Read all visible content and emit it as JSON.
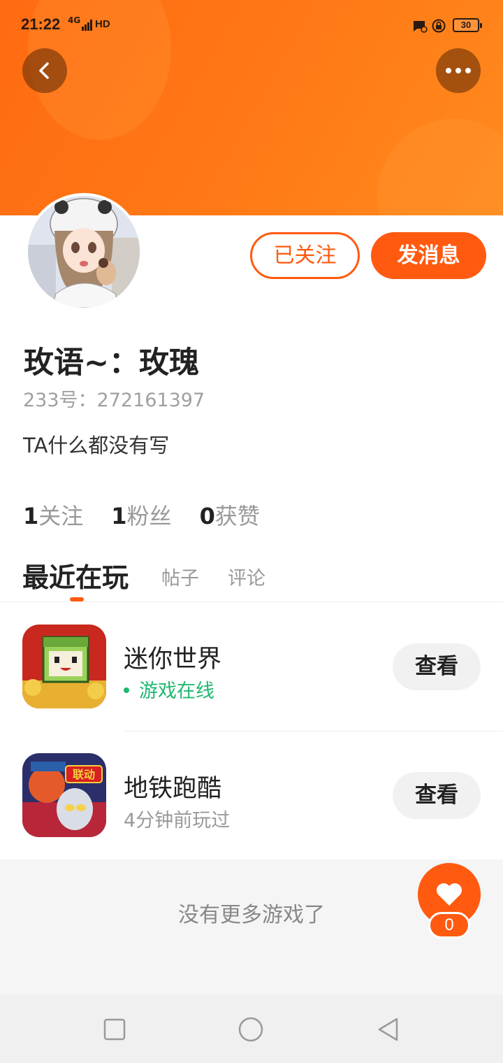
{
  "status_bar": {
    "time": "21:22",
    "network": "4G",
    "hd": "HD",
    "battery": "30"
  },
  "profile": {
    "follow_button": "已关注",
    "message_button": "发消息",
    "name": "玫语~：玫瑰",
    "id_text": "233号：272161397",
    "bio": "TA什么都没有写"
  },
  "stats": [
    {
      "count": "1",
      "label": "关注"
    },
    {
      "count": "1",
      "label": "粉丝"
    },
    {
      "count": "0",
      "label": "获赞"
    }
  ],
  "tabs": [
    "最近在玩",
    "帖子",
    "评论"
  ],
  "games": [
    {
      "title": "迷你世界",
      "status": "游戏在线",
      "button": "查看"
    },
    {
      "title": "地铁跑酷",
      "status": "4分钟前玩过",
      "button": "查看",
      "badge": "联动"
    }
  ],
  "footer": {
    "no_more": "没有更多游戏了"
  },
  "like": {
    "count": "0"
  },
  "colors": {
    "accent": "#ff5a10",
    "online": "#1fb870",
    "header": "#ff7a16"
  }
}
